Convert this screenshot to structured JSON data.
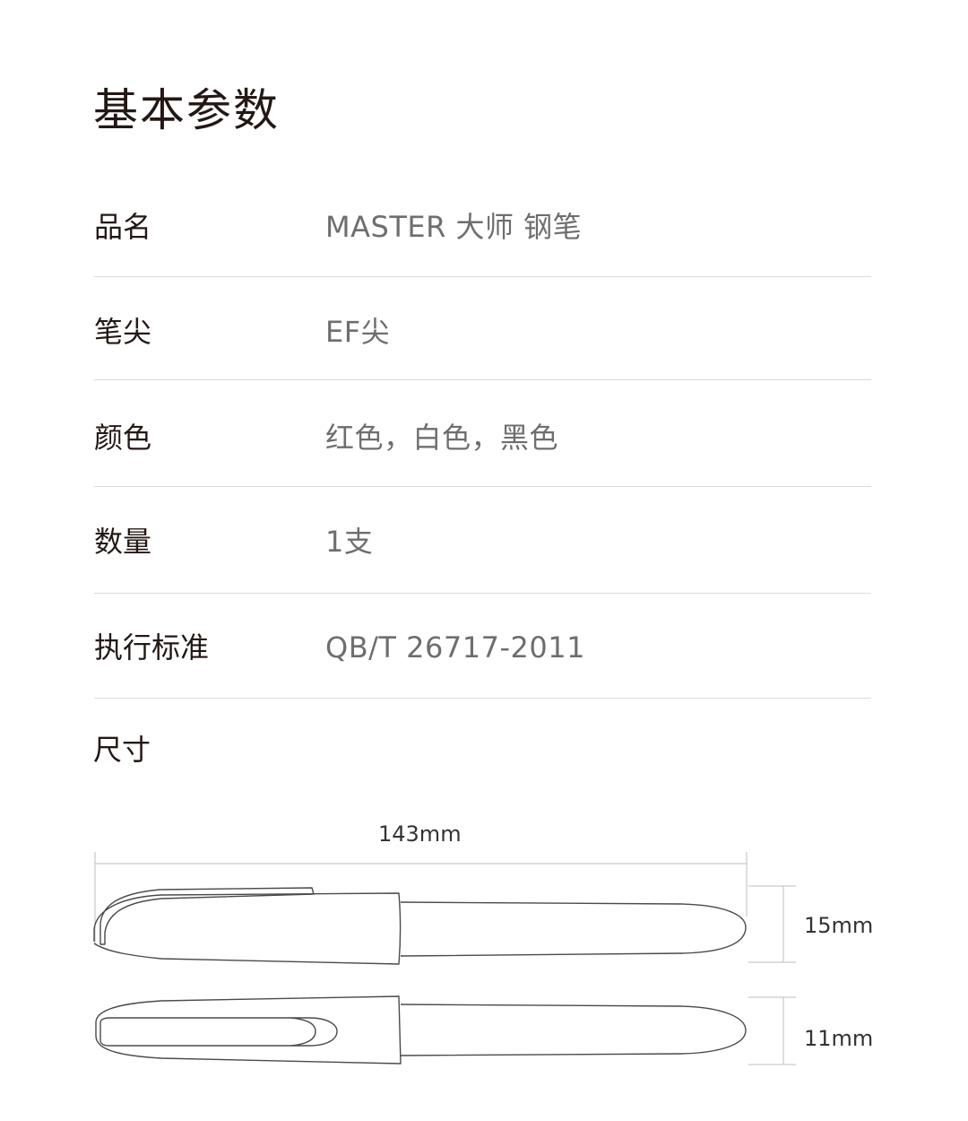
{
  "title": "基本参数",
  "specs": [
    {
      "label": "品名",
      "value": "MASTER 大师 钢笔"
    },
    {
      "label": "笔尖",
      "value": "EF尖"
    },
    {
      "label": "颜色",
      "value": "红色，白色，黑色"
    },
    {
      "label": "数量",
      "value": "1支"
    },
    {
      "label": "执行标准",
      "value": "QB/T 26717-2011"
    }
  ],
  "size": {
    "heading": "尺寸",
    "length_label": "143mm",
    "height_side_label": "15mm",
    "height_top_label": "11mm"
  }
}
